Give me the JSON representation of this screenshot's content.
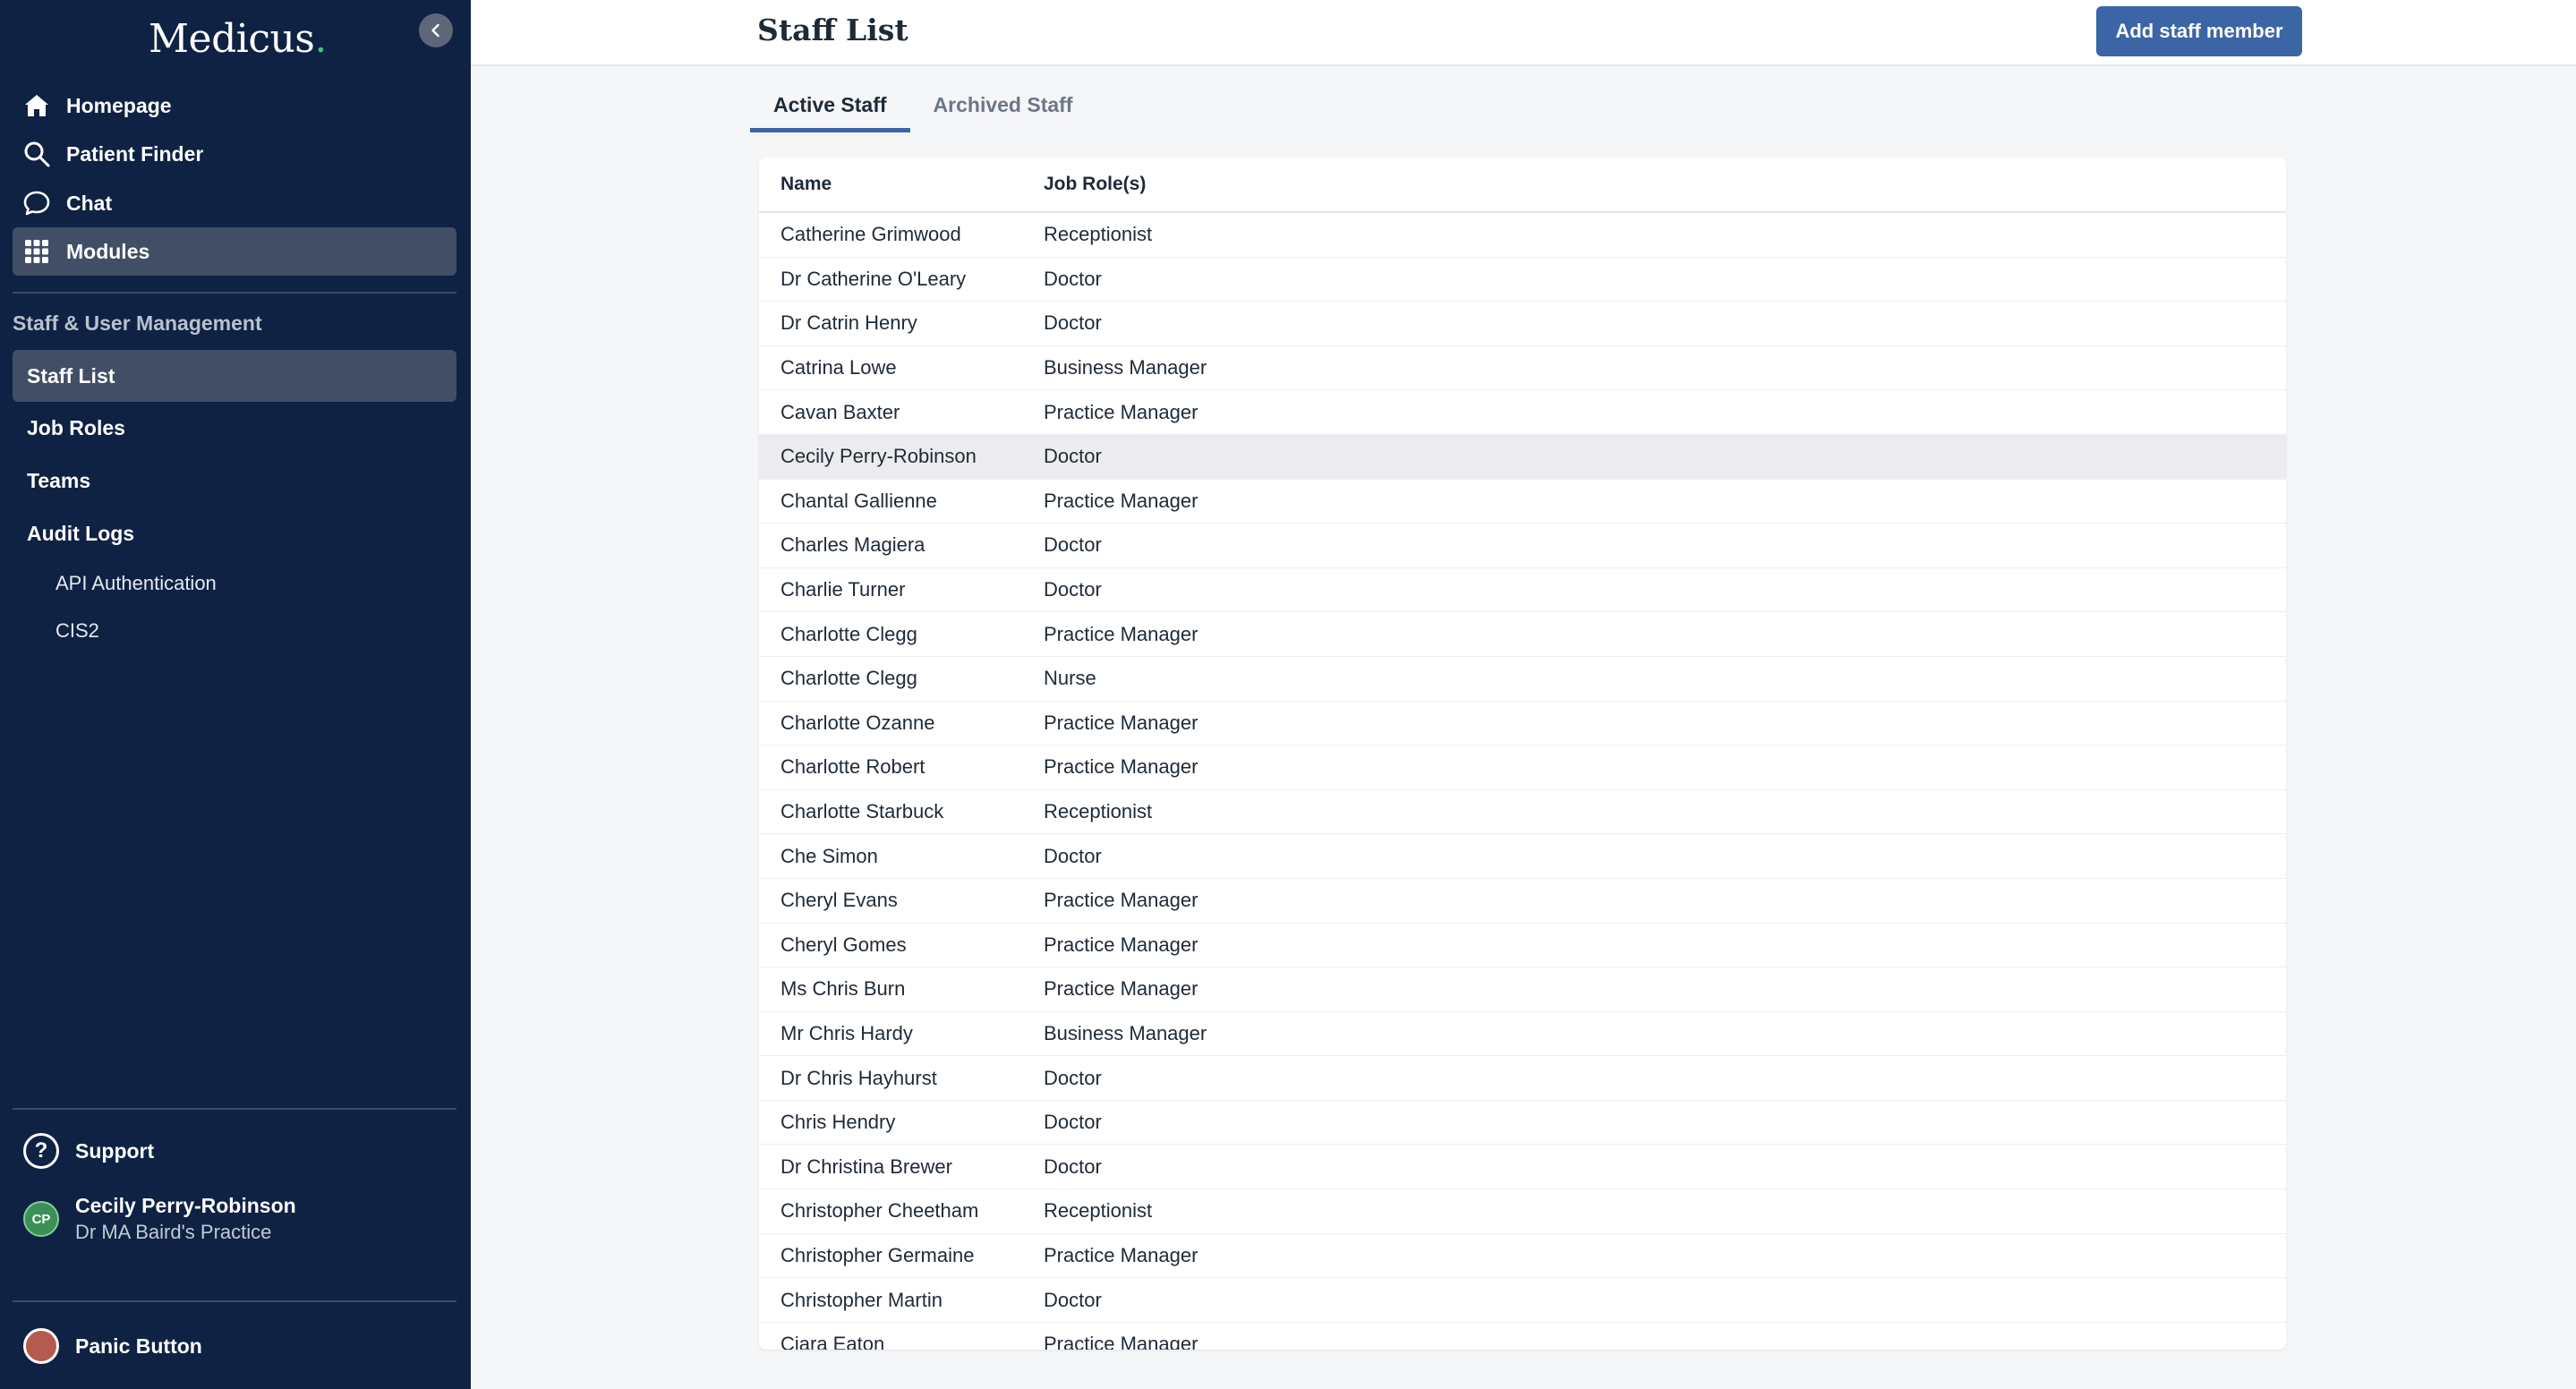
{
  "brand": {
    "name": "Medicus",
    "dot": "."
  },
  "nav": [
    {
      "label": "Homepage",
      "icon": "home-icon"
    },
    {
      "label": "Patient Finder",
      "icon": "search-icon"
    },
    {
      "label": "Chat",
      "icon": "chat-bubble-icon"
    },
    {
      "label": "Modules",
      "icon": "grid-icon",
      "active": true
    }
  ],
  "section": {
    "title": "Staff & User Management",
    "items": [
      {
        "label": "Staff List",
        "active": true
      },
      {
        "label": "Job Roles"
      },
      {
        "label": "Teams"
      },
      {
        "label": "Audit Logs"
      }
    ],
    "audit_sub": [
      {
        "label": "API Authentication"
      },
      {
        "label": "CIS2"
      }
    ]
  },
  "footer": {
    "support": "Support",
    "user_initials": "CP",
    "user_name": "Cecily Perry-Robinson",
    "user_practice": "Dr MA Baird's Practice",
    "panic": "Panic Button"
  },
  "header": {
    "title": "Staff List",
    "add_button": "Add staff member"
  },
  "tabs": [
    {
      "label": "Active Staff",
      "active": true
    },
    {
      "label": "Archived Staff"
    }
  ],
  "table": {
    "columns": [
      "Name",
      "Job Role(s)"
    ],
    "rows": [
      {
        "name": "Catherine Grimwood",
        "role": "Receptionist"
      },
      {
        "name": "Dr Catherine O'Leary",
        "role": "Doctor"
      },
      {
        "name": "Dr Catrin Henry",
        "role": "Doctor"
      },
      {
        "name": "Catrina Lowe",
        "role": "Business Manager"
      },
      {
        "name": "Cavan Baxter",
        "role": "Practice Manager"
      },
      {
        "name": "Cecily Perry-Robinson",
        "role": "Doctor",
        "highlighted": true
      },
      {
        "name": "Chantal Gallienne",
        "role": "Practice Manager"
      },
      {
        "name": "Charles Magiera",
        "role": "Doctor"
      },
      {
        "name": "Charlie Turner",
        "role": "Doctor"
      },
      {
        "name": "Charlotte Clegg",
        "role": "Practice Manager"
      },
      {
        "name": "Charlotte Clegg",
        "role": "Nurse"
      },
      {
        "name": "Charlotte Ozanne",
        "role": "Practice Manager"
      },
      {
        "name": "Charlotte Robert",
        "role": "Practice Manager"
      },
      {
        "name": "Charlotte Starbuck",
        "role": "Receptionist"
      },
      {
        "name": "Che Simon",
        "role": "Doctor"
      },
      {
        "name": "Cheryl Evans",
        "role": "Practice Manager"
      },
      {
        "name": "Cheryl Gomes",
        "role": "Practice Manager"
      },
      {
        "name": "Ms Chris Burn",
        "role": "Practice Manager"
      },
      {
        "name": "Mr Chris Hardy",
        "role": "Business Manager"
      },
      {
        "name": "Dr Chris Hayhurst",
        "role": "Doctor"
      },
      {
        "name": "Chris Hendry",
        "role": "Doctor"
      },
      {
        "name": "Dr Christina Brewer",
        "role": "Doctor"
      },
      {
        "name": "Christopher Cheetham",
        "role": "Receptionist"
      },
      {
        "name": "Christopher Germaine",
        "role": "Practice Manager"
      },
      {
        "name": "Christopher Martin",
        "role": "Doctor"
      },
      {
        "name": "Ciara Eaton",
        "role": "Practice Manager"
      }
    ]
  },
  "colors": {
    "sidebar_bg": "#0f2244",
    "active_bg": "#414e66",
    "accent": "#3c65a5",
    "brand_dot": "#3fbf8a",
    "panic": "#b55a4f"
  }
}
